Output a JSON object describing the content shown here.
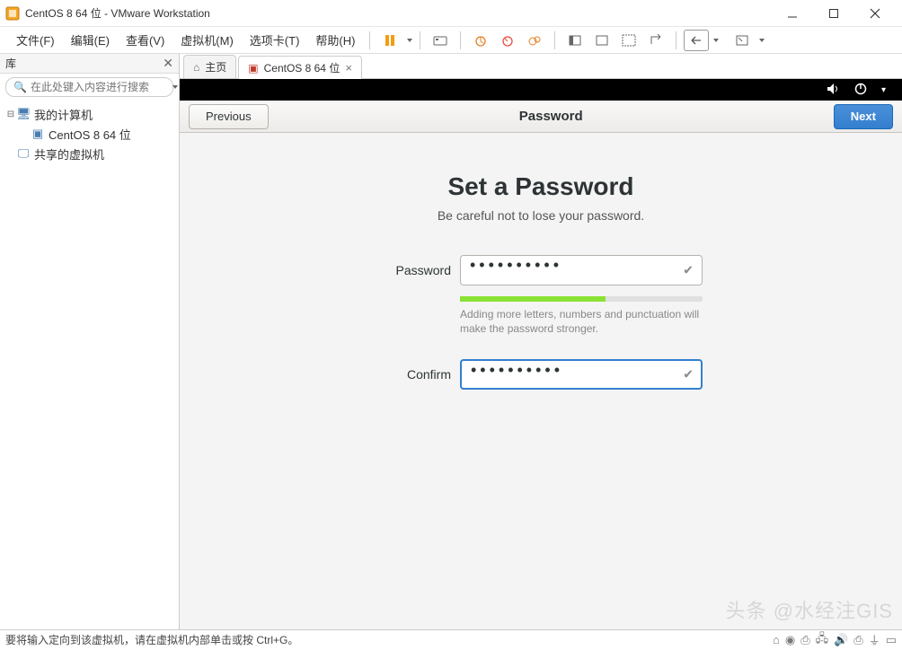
{
  "titlebar": {
    "title": "CentOS 8 64 位 - VMware Workstation"
  },
  "menu": {
    "file": "文件(F)",
    "edit": "编辑(E)",
    "view": "查看(V)",
    "vm": "虚拟机(M)",
    "tabs": "选项卡(T)",
    "help": "帮助(H)"
  },
  "sidebar": {
    "title": "库",
    "search_placeholder": "在此处键入内容进行搜索",
    "nodes": {
      "my_computer": "我的计算机",
      "centos": "CentOS 8 64 位",
      "shared": "共享的虚拟机"
    }
  },
  "tabs": {
    "home": "主页",
    "vm": "CentOS 8 64 位"
  },
  "gnome": {
    "previous": "Previous",
    "title": "Password",
    "next": "Next",
    "heading": "Set a Password",
    "subtitle": "Be careful not to lose your password.",
    "password_label": "Password",
    "confirm_label": "Confirm",
    "password_value": "••••••••••",
    "confirm_value": "••••••••••",
    "hint": "Adding more letters, numbers and punctuation will make the password stronger.",
    "strength_pct": 60
  },
  "statusbar": {
    "message": "要将输入定向到该虚拟机，请在虚拟机内部单击或按 Ctrl+G。"
  },
  "watermark": "头条 @水经注GIS"
}
